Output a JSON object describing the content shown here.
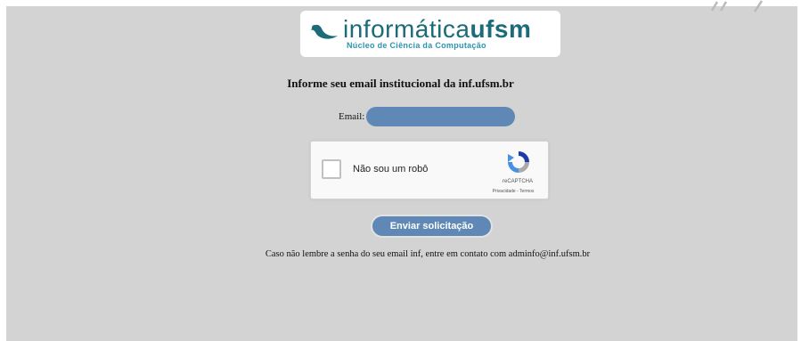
{
  "logo": {
    "name_part1": "informática",
    "name_part2": "ufsm",
    "subtitle": "Núcleo de Ciência da Computação",
    "swoosh_color": "#1c6b78",
    "text_color": "#1c6b78",
    "subtitle_color": "#2b94b0",
    "icon": "swoosh-logo-icon"
  },
  "form": {
    "heading": "Informe seu email institucional da inf.ufsm.br",
    "email_label": "Email:",
    "email_value": "",
    "email_placeholder": "",
    "submit_label": "Enviar solicitação",
    "accent_color": "#5f88b6"
  },
  "recaptcha": {
    "checkbox_label": "Não sou um robô",
    "checked": false,
    "brand": "reCAPTCHA",
    "terms": "Privacidade - Termos",
    "icon": "recaptcha-logo-icon"
  },
  "footer": {
    "text": "Caso não lembre a senha do seu email inf, entre em contato com adminfo@inf.ufsm.br"
  },
  "colors": {
    "background": "#d3d3d3"
  }
}
